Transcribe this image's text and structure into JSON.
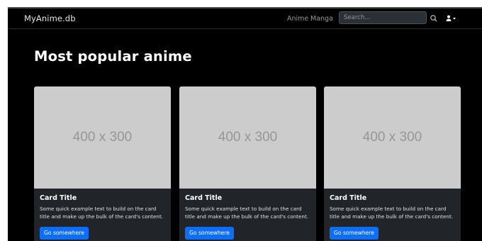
{
  "navbar": {
    "brand": "MyAnime.db",
    "links": [
      "Anime",
      "Manga"
    ],
    "search_placeholder": "Search...",
    "search_icon": "search-icon",
    "user_icon": "user-icon"
  },
  "main": {
    "title": "Most popular anime",
    "cards": [
      {
        "image_label": "400 x 300",
        "title": "Card Title",
        "text": "Some quick example text to build on the card title and make up the bulk of the card's content.",
        "button": "Go somewhere"
      },
      {
        "image_label": "400 x 300",
        "title": "Card Title",
        "text": "Some quick example text to build on the card title and make up the bulk of the card's content.",
        "button": "Go somewhere"
      },
      {
        "image_label": "400 x 300",
        "title": "Card Title",
        "text": "Some quick example text to build on the card title and make up the bulk of the card's content.",
        "button": "Go somewhere"
      }
    ]
  },
  "colors": {
    "background": "#000000",
    "card_background": "#212529",
    "placeholder": "#cccccc",
    "primary": "#0d6efd"
  }
}
